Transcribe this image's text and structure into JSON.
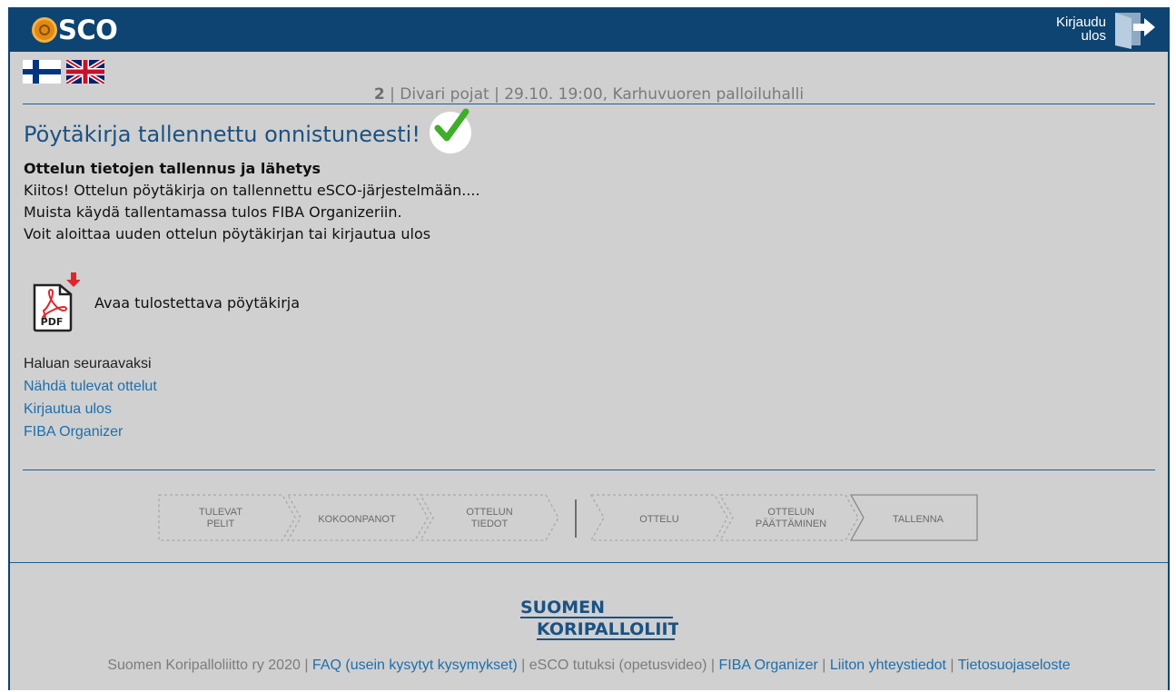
{
  "header": {
    "logo_text": "SCO",
    "logout_line1": "Kirjaudu",
    "logout_line2": "ulos"
  },
  "languages": [
    {
      "name": "Finnish",
      "icon": "finland-flag-icon"
    },
    {
      "name": "English",
      "icon": "uk-flag-icon"
    }
  ],
  "match": {
    "number": "2",
    "details": " | Divari pojat | 29.10. 19:00, Karhuvuoren palloiluhalli"
  },
  "success": {
    "title": "Pöytäkirja tallennettu onnistuneesti!",
    "check_icon": "checkmark-icon"
  },
  "content": {
    "heading": "Ottelun tietojen tallennus ja lähetys",
    "line1": "Kiitos! Ottelun pöytäkirja on tallennettu eSCO-järjestelmään....",
    "line2": "Muista käydä tallentamassa tulos FIBA Organizeriin.",
    "line3": "Voit aloittaa uuden ottelun pöytäkirjan tai kirjautua ulos"
  },
  "pdf": {
    "icon_text": "PDF",
    "label": "Avaa tulostettava pöytäkirja"
  },
  "next": {
    "title": "Haluan seuraavaksi",
    "links": [
      "Nähdä tulevat ottelut",
      "Kirjautua ulos",
      "FIBA Organizer"
    ]
  },
  "steps": [
    {
      "line1": "TULEVAT",
      "line2": "PELIT"
    },
    {
      "line1": "KOKOONPANOT",
      "line2": ""
    },
    {
      "line1": "OTTELUN",
      "line2": "TIEDOT"
    },
    {
      "line1": "OTTELU",
      "line2": ""
    },
    {
      "line1": "OTTELUN",
      "line2": "PÄÄTTÄMINEN"
    },
    {
      "line1": "TALLENNA",
      "line2": ""
    }
  ],
  "footer": {
    "logo_line1": "SUOMEN",
    "logo_line2": "KORIPALLOLIITTO",
    "copyright": "Suomen Koripalloliitto ry 2020",
    "faq": "FAQ (usein kysytyt kysymykset)",
    "support": "eSCO tutuksi (opetusvideo)",
    "fiba": "FIBA Organizer",
    "contact": "Liiton yhteystiedot",
    "privacy": "Tietosuojaseloste",
    "separator": " | "
  },
  "colors": {
    "header_bg": "#0e4472",
    "page_bg": "#d0d0d0",
    "link": "#1d6fad",
    "title": "#1a5284",
    "success_check": "#3fae2a"
  }
}
